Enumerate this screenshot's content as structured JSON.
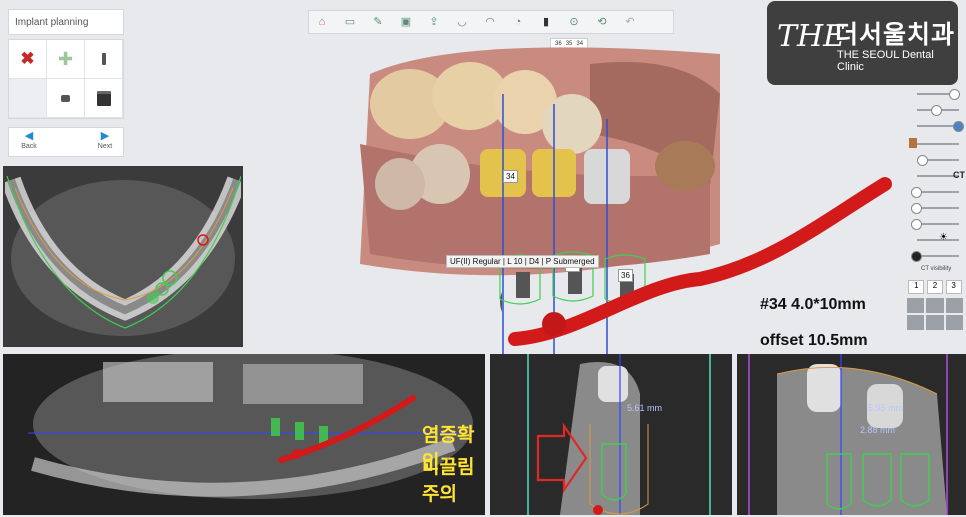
{
  "plan_panel": {
    "title": "Implant planning",
    "nav_back": "Back",
    "nav_next": "Next",
    "tools": [
      "delete-icon",
      "add-icon",
      "implant-icon",
      "",
      "abutment-icon",
      "sleeve-icon"
    ]
  },
  "toolbar": {
    "buttons": [
      "home-icon",
      "panorama-icon",
      "edit-icon",
      "scan-icon",
      "upload-icon",
      "arch-icon",
      "jaw-icon",
      "crown-icon",
      "implant-icon",
      "sleeve-icon",
      "rotate-icon",
      "undo-icon"
    ],
    "tooth_tabs": [
      "36",
      "35",
      "34"
    ]
  },
  "logo": {
    "mark": "THE",
    "korean": "더서울치과",
    "english": "THE SEOUL Dental Clinic"
  },
  "model_view": {
    "implant_tooltip": "UF(II) Regular | L 10 | D4 | P Submerged",
    "tooth_labels": [
      "34",
      "35",
      "36"
    ],
    "annotation_spec": "#34 4.0*10mm",
    "annotation_offset": "offset 10.5mm"
  },
  "slider_panel": {
    "ct_label": "CT",
    "ct_visibility": "CT visibility",
    "view_buttons": [
      "1",
      "2",
      "3"
    ]
  },
  "pano_view": {
    "annotation_line1": "염증확인",
    "annotation_line2": "미끌림주의"
  },
  "cross_view_1": {
    "measure": "5.61 mm"
  },
  "cross_view_2": {
    "measure_1": "5.95 mm",
    "measure_2": "2.88 mm"
  },
  "colors": {
    "nerve": "#d21a1a",
    "implant_outline": "#4fd05a",
    "gold": "#e5c04a",
    "accent": "#1f8ad6"
  }
}
